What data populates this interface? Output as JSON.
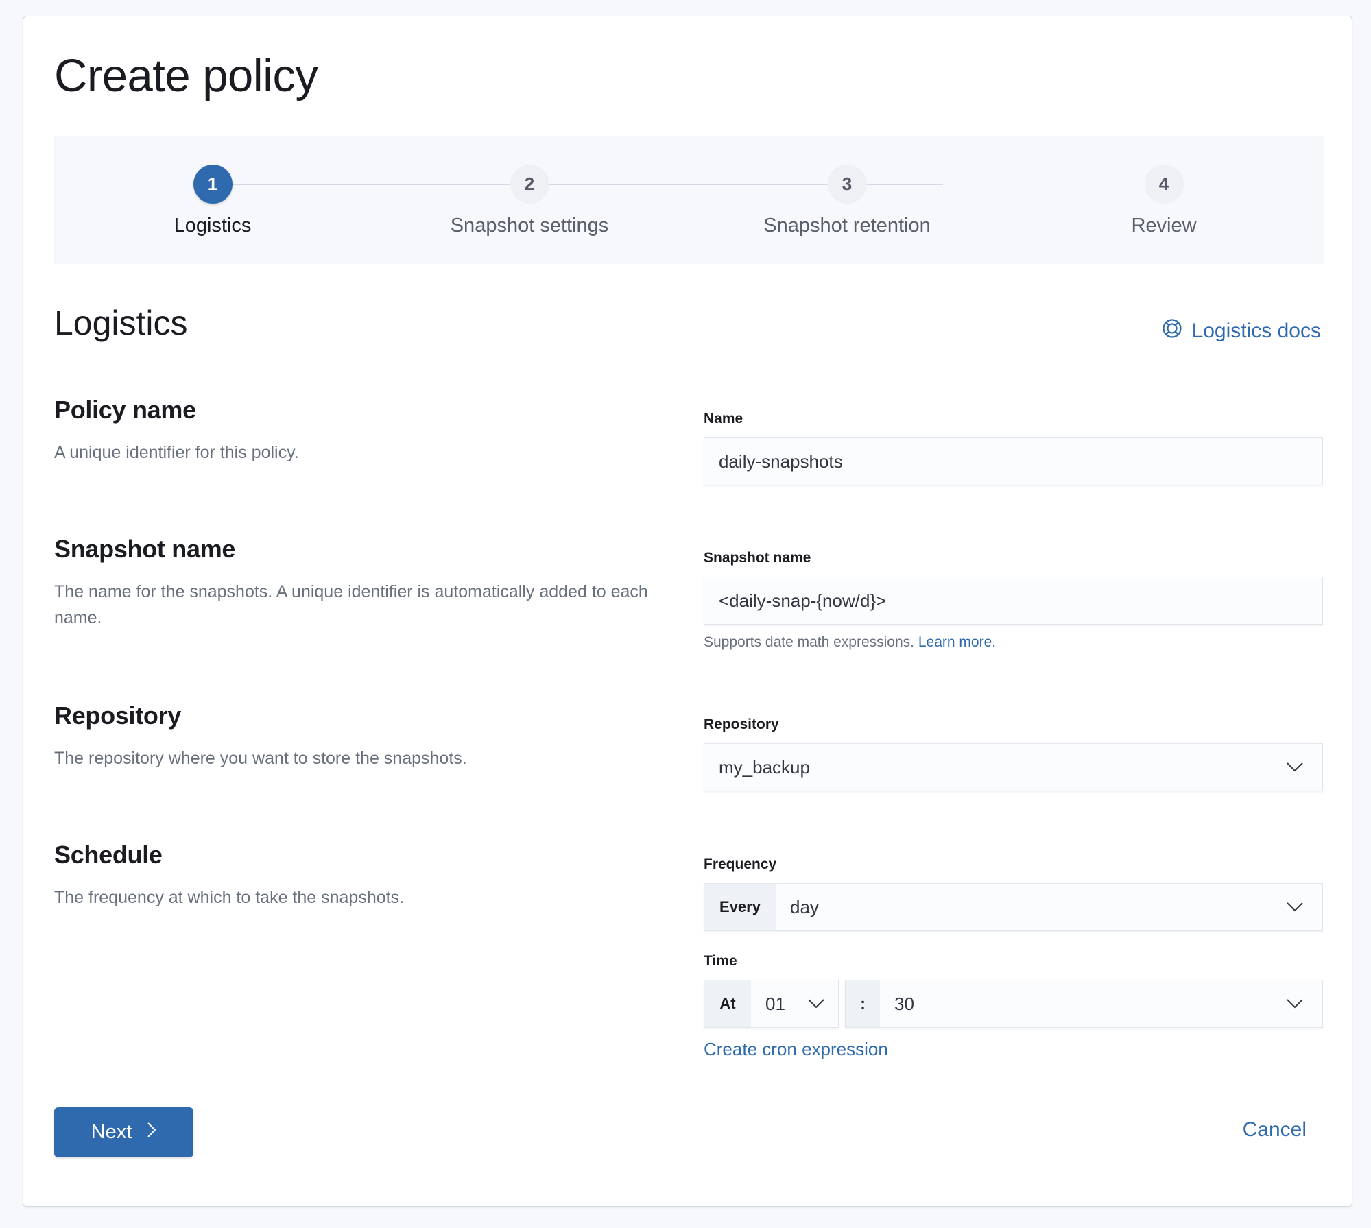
{
  "page": {
    "title": "Create policy"
  },
  "stepper": {
    "steps": [
      {
        "number": "1",
        "label": "Logistics",
        "state": "active"
      },
      {
        "number": "2",
        "label": "Snapshot settings",
        "state": "incomplete"
      },
      {
        "number": "3",
        "label": "Snapshot retention",
        "state": "incomplete"
      },
      {
        "number": "4",
        "label": "Review",
        "state": "incomplete"
      }
    ]
  },
  "section": {
    "title": "Logistics",
    "docs_link": "Logistics docs",
    "docs_icon": "lifebuoy-icon"
  },
  "groups": {
    "policy_name": {
      "title": "Policy name",
      "description": "A unique identifier for this policy.",
      "field_label": "Name",
      "value": "daily-snapshots"
    },
    "snapshot_name": {
      "title": "Snapshot name",
      "description": "The name for the snapshots. A unique identifier is automatically added to each name.",
      "field_label": "Snapshot name",
      "value": "<daily-snap-{now/d}>",
      "help_text": "Supports date math expressions.",
      "help_link": "Learn more."
    },
    "repository": {
      "title": "Repository",
      "description": "The repository where you want to store the snapshots.",
      "field_label": "Repository",
      "value": "my_backup"
    },
    "schedule": {
      "title": "Schedule",
      "description": "The frequency at which to take the snapshots.",
      "frequency_label": "Frequency",
      "frequency_prepend": "Every",
      "frequency_value": "day",
      "time_label": "Time",
      "time_prepend": "At",
      "hour_value": "01",
      "separator": ":",
      "minute_value": "30",
      "cron_link": "Create cron expression"
    }
  },
  "footer": {
    "next_label": "Next",
    "cancel_label": "Cancel"
  },
  "colors": {
    "accent": "#2f6aaf",
    "background": "#f7f8fc"
  }
}
